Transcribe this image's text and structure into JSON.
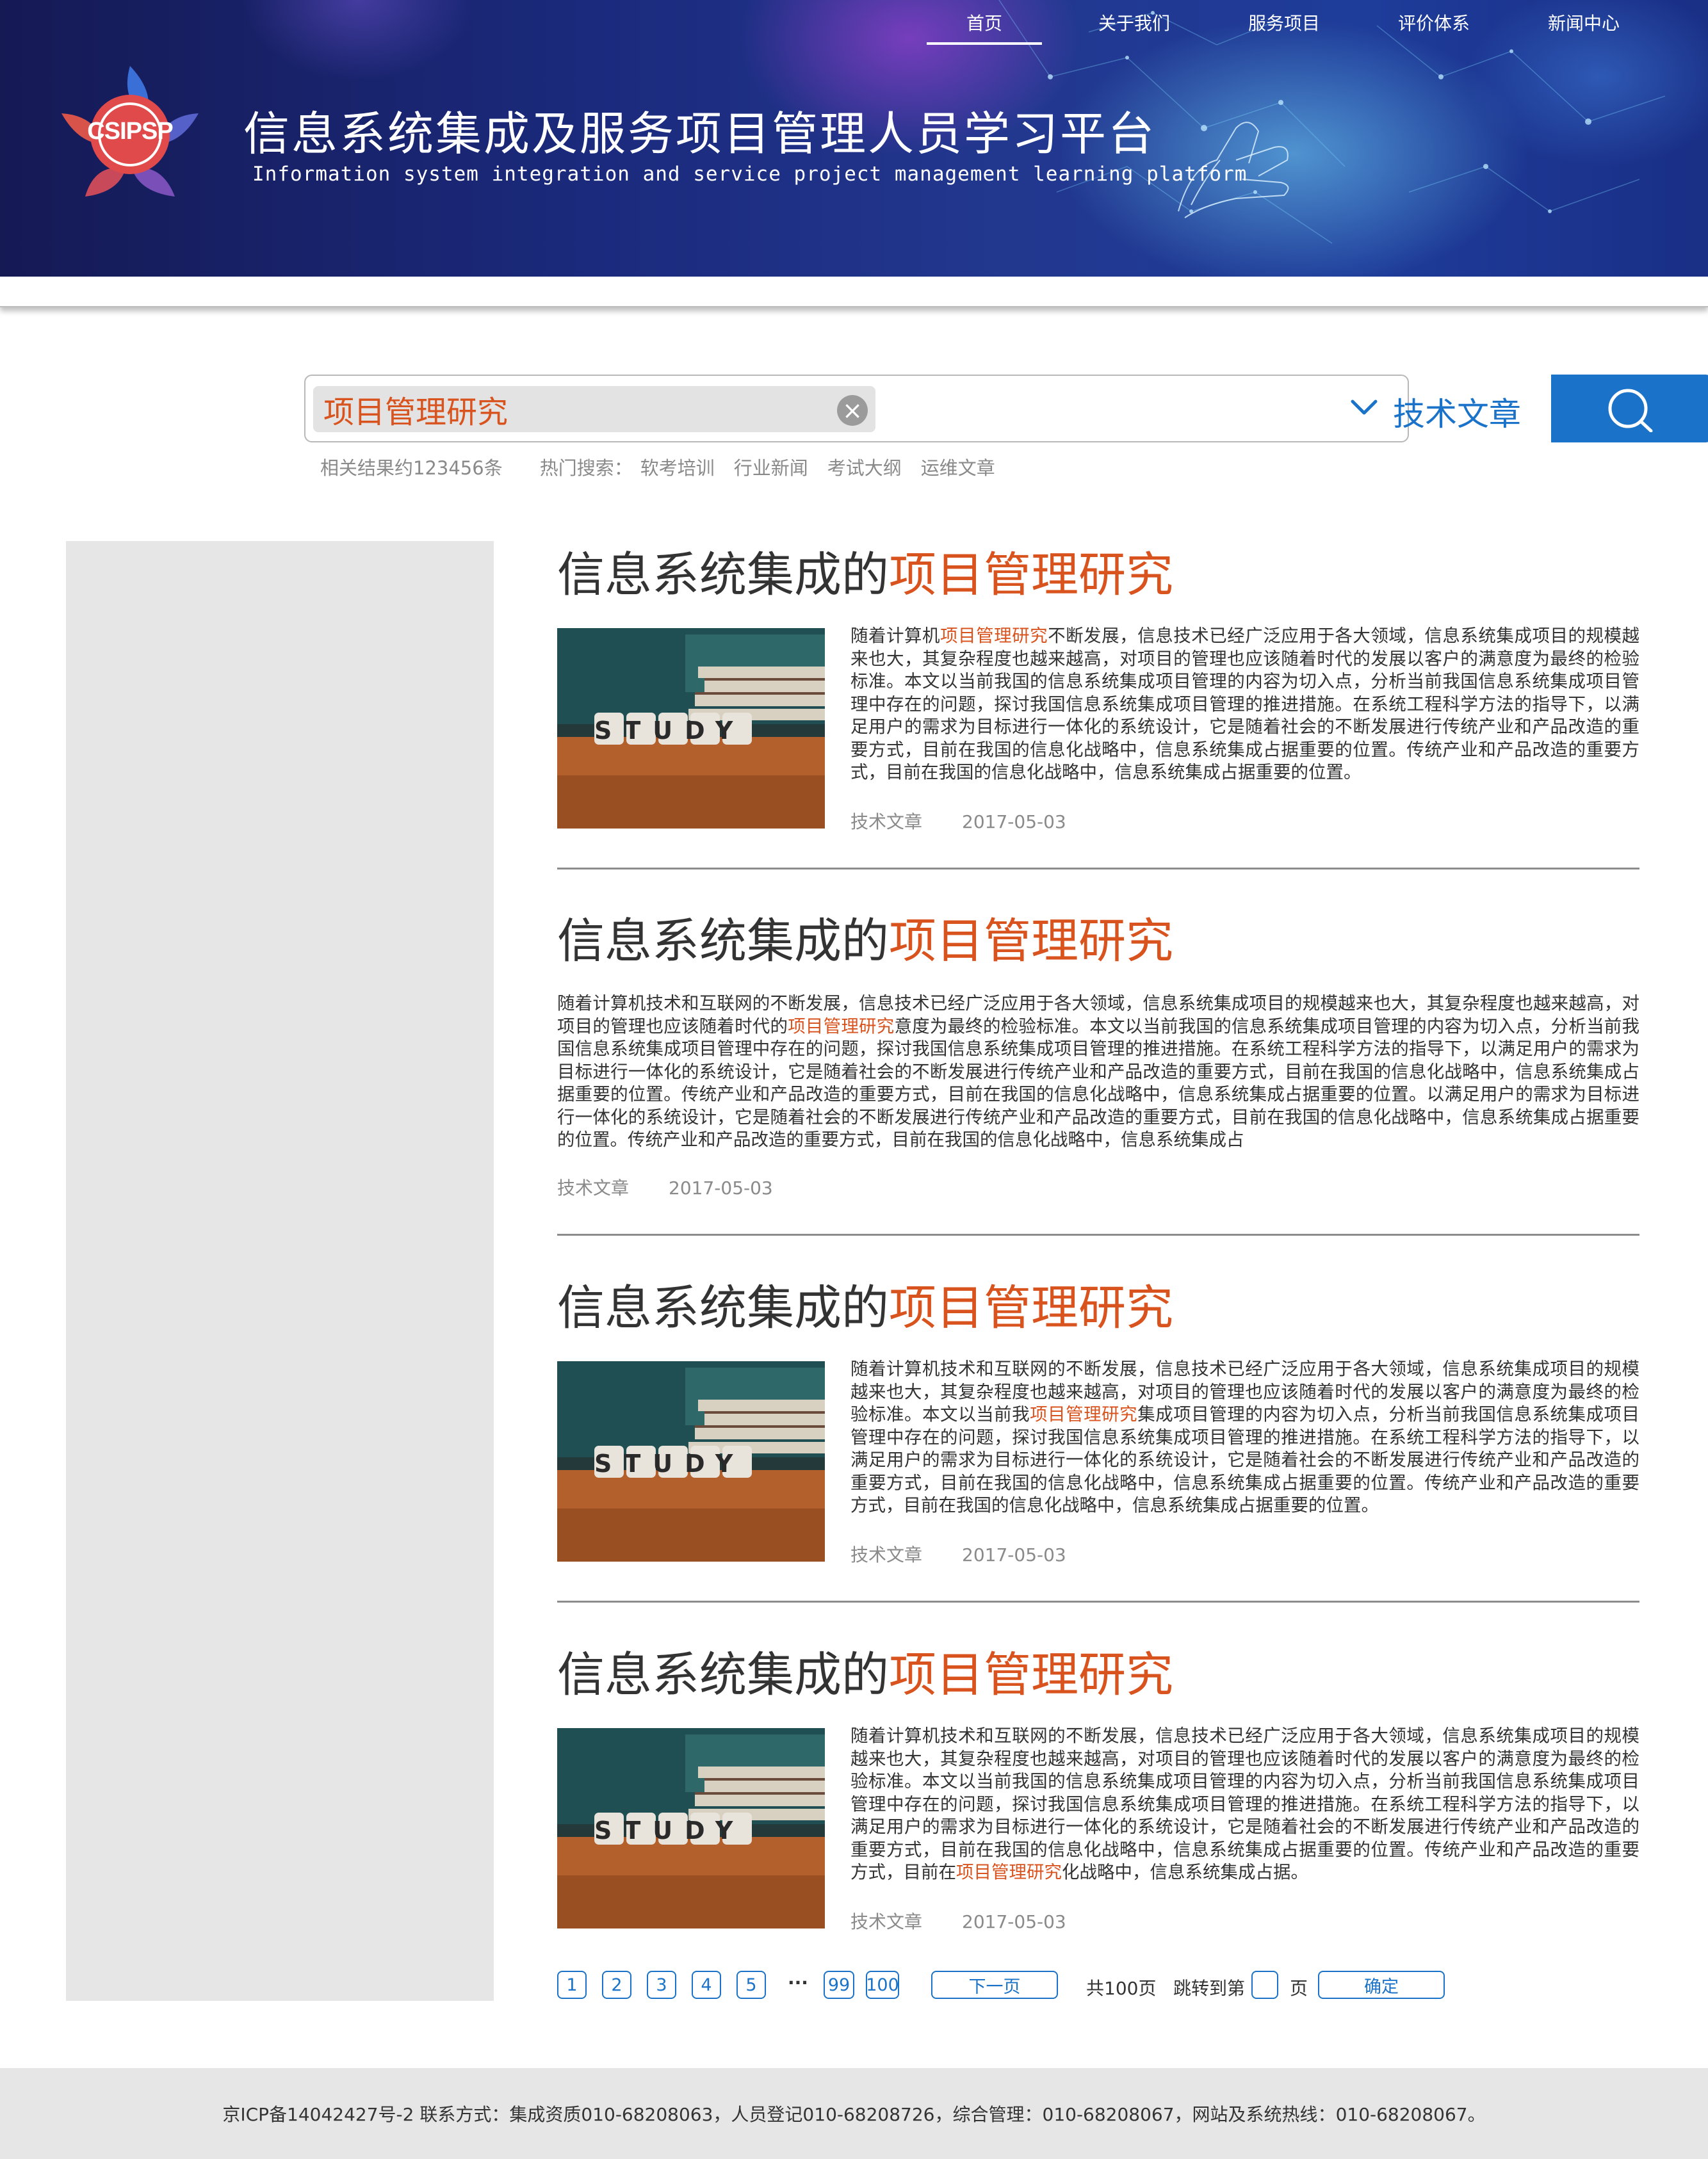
{
  "header": {
    "logo_text": "CSIPSP",
    "title": "信息系统集成及服务项目管理人员学习平台",
    "subtitle": "Information system integration and service project management learning platform",
    "nav": [
      {
        "label": "首页",
        "active": true
      },
      {
        "label": "关于我们",
        "active": false
      },
      {
        "label": "服务项目",
        "active": false
      },
      {
        "label": "评价体系",
        "active": false
      },
      {
        "label": "新闻中心",
        "active": false
      }
    ]
  },
  "search": {
    "query": "项目管理研究",
    "category": "技术文章",
    "result_count": "相关结果约123456条",
    "hot_label": "热门搜索：",
    "hot_terms": [
      "软考培训",
      "行业新闻",
      "考试大纲",
      "运维文章"
    ]
  },
  "articles": [
    {
      "title_prefix": "信息系统集成的",
      "title_highlight": "项目管理研究",
      "has_image": true,
      "thumb_text": "STUDY",
      "summary_before": "随着计算机",
      "summary_highlight": "项目管理研究",
      "summary_after": "不断发展，信息技术已经广泛应用于各大领域，信息系统集成项目的规模越来也大，其复杂程度也越来越高，对项目的管理也应该随着时代的发展以客户的满意度为最终的检验标准。本文以当前我国的信息系统集成项目管理的内容为切入点，分析当前我国信息系统集成项目管理中存在的问题，探讨我国信息系统集成项目管理的推进措施。在系统工程科学方法的指导下，以满足用户的需求为目标进行一体化的系统设计，它是随着社会的不断发展进行传统产业和产品改造的重要方式，目前在我国的信息化战略中，信息系统集成占据重要的位置。传统产业和产品改造的重要方式，目前在我国的信息化战略中，信息系统集成占据重要的位置。",
      "category": "技术文章",
      "date": "2017-05-03"
    },
    {
      "title_prefix": "信息系统集成的",
      "title_highlight": "项目管理研究",
      "has_image": false,
      "summary_before": "随着计算机技术和互联网的不断发展，信息技术已经广泛应用于各大领域，信息系统集成项目的规模越来也大，其复杂程度也越来越高，对项目的管理也应该随着时代的",
      "summary_highlight": "项目管理研究",
      "summary_after": "意度为最终的检验标准。本文以当前我国的信息系统集成项目管理的内容为切入点，分析当前我国信息系统集成项目管理中存在的问题，探讨我国信息系统集成项目管理的推进措施。在系统工程科学方法的指导下，以满足用户的需求为目标进行一体化的系统设计，它是随着社会的不断发展进行传统产业和产品改造的重要方式，目前在我国的信息化战略中，信息系统集成占据重要的位置。传统产业和产品改造的重要方式，目前在我国的信息化战略中，信息系统集成占据重要的位置。以满足用户的需求为目标进行一体化的系统设计，它是随着社会的不断发展进行传统产业和产品改造的重要方式，目前在我国的信息化战略中，信息系统集成占据重要的位置。传统产业和产品改造的重要方式，目前在我国的信息化战略中，信息系统集成占",
      "category": "技术文章",
      "date": "2017-05-03"
    },
    {
      "title_prefix": "信息系统集成的",
      "title_highlight": "项目管理研究",
      "has_image": true,
      "thumb_text": "STUDY",
      "summary_before": "随着计算机技术和互联网的不断发展，信息技术已经广泛应用于各大领域，信息系统集成项目的规模越来也大，其复杂程度也越来越高，对项目的管理也应该随着时代的发展以客户的满意度为最终的检验标准。本文以当前我",
      "summary_highlight": "项目管理研究",
      "summary_after": "集成项目管理的内容为切入点，分析当前我国信息系统集成项目管理中存在的问题，探讨我国信息系统集成项目管理的推进措施。在系统工程科学方法的指导下，以满足用户的需求为目标进行一体化的系统设计，它是随着社会的不断发展进行传统产业和产品改造的重要方式，目前在我国的信息化战略中，信息系统集成占据重要的位置。传统产业和产品改造的重要方式，目前在我国的信息化战略中，信息系统集成占据重要的位置。",
      "category": "技术文章",
      "date": "2017-05-03"
    },
    {
      "title_prefix": "信息系统集成的",
      "title_highlight": "项目管理研究",
      "has_image": true,
      "thumb_text": "STUDY",
      "summary_before": "随着计算机技术和互联网的不断发展，信息技术已经广泛应用于各大领域，信息系统集成项目的规模越来也大，其复杂程度也越来越高，对项目的管理也应该随着时代的发展以客户的满意度为最终的检验标准。本文以当前我国的信息系统集成项目管理的内容为切入点，分析当前我国信息系统集成项目管理中存在的问题，探讨我国信息系统集成项目管理的推进措施。在系统工程科学方法的指导下，以满足用户的需求为目标进行一体化的系统设计，它是随着社会的不断发展进行传统产业和产品改造的重要方式，目前在我国的信息化战略中，信息系统集成占据重要的位置。传统产业和产品改造的重要方式，目前在",
      "summary_highlight": "项目管理研究",
      "summary_after": "化战略中，信息系统集成占据。",
      "category": "技术文章",
      "date": "2017-05-03"
    }
  ],
  "pagination": {
    "pages": [
      "1",
      "2",
      "3",
      "4",
      "5"
    ],
    "ellipsis": "···",
    "last_pages": [
      "99",
      "100"
    ],
    "next_label": "下一页",
    "total_label": "共100页",
    "jump_label": "跳转到第",
    "jump_suffix": "页",
    "confirm_label": "确定"
  },
  "footer": {
    "text": "京ICP备14042427号-2  联系方式：集成资质010-68208063，人员登记010-68208726，综合管理：010-68208067，网站及系统热线：010-68208067。"
  },
  "colors": {
    "accent": "#1a73c8",
    "highlight": "#d9531e",
    "banner_dark": "#151a55",
    "sidebar": "#e6e6e6"
  }
}
